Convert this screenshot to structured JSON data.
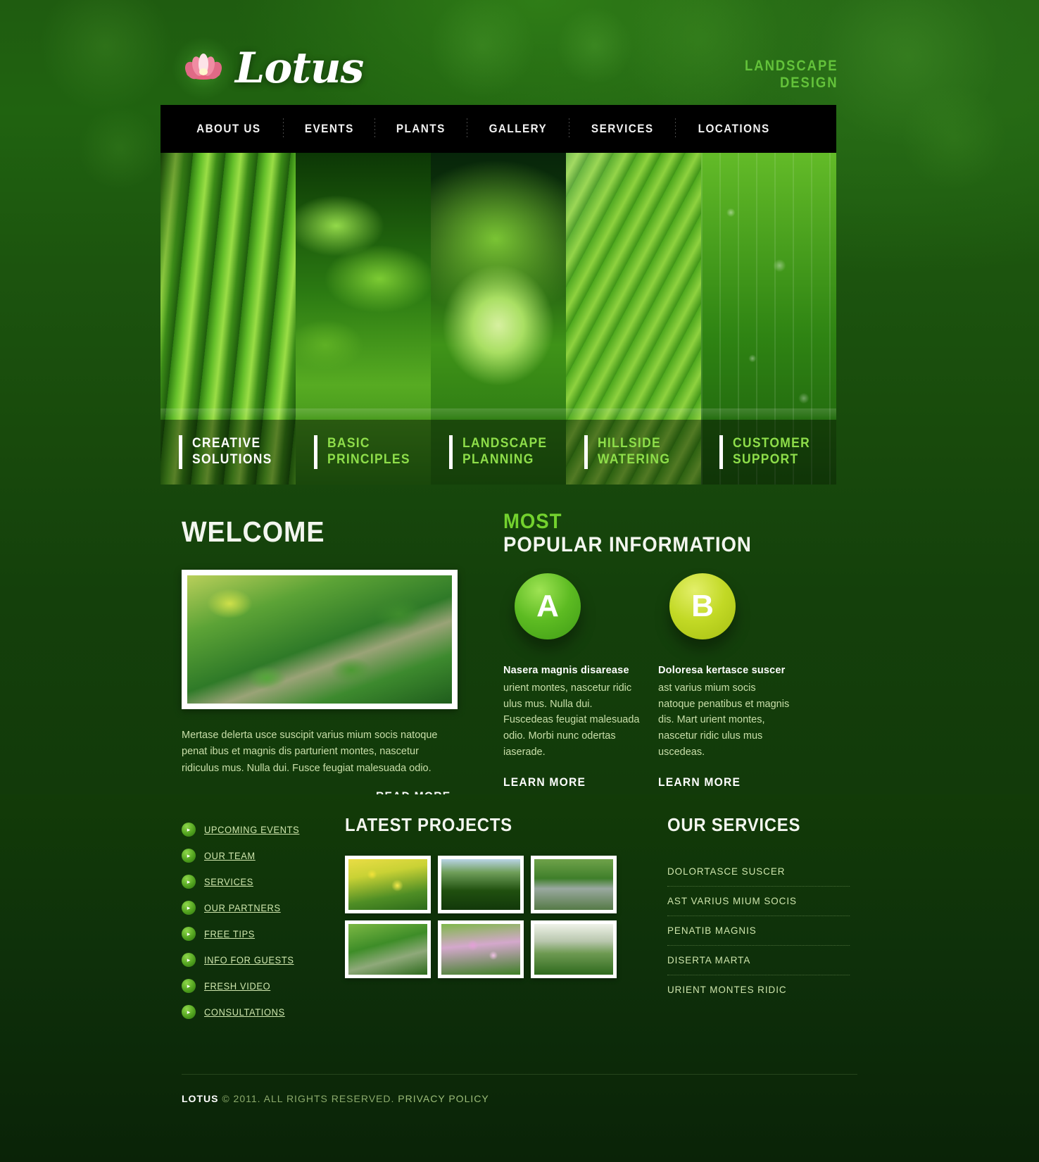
{
  "brand": {
    "name": "Lotus",
    "icon": "lotus-flower-icon",
    "tagline_line1": "LANDSCAPE",
    "tagline_line2": "DESIGN",
    "accent_green": "#73d22e",
    "tagline_color": "#63c23a"
  },
  "nav": {
    "items": [
      {
        "label": "ABOUT US"
      },
      {
        "label": "EVENTS"
      },
      {
        "label": "PLANTS"
      },
      {
        "label": "GALLERY"
      },
      {
        "label": "SERVICES"
      },
      {
        "label": "LOCATIONS"
      }
    ]
  },
  "slider": {
    "slides": [
      {
        "line1": "CREATIVE",
        "line2": "SOLUTIONS",
        "style": "white"
      },
      {
        "line1": "BASIC",
        "line2": "PRINCIPLES",
        "style": "green"
      },
      {
        "line1": "LANDSCAPE",
        "line2": "PLANNING",
        "style": "green"
      },
      {
        "line1": "HILLSIDE",
        "line2": "WATERING",
        "style": "green"
      },
      {
        "line1": "CUSTOMER",
        "line2": "SUPPORT",
        "style": "green"
      }
    ]
  },
  "welcome": {
    "heading": "WELCOME",
    "image_alt": "garden-path-photo",
    "body": "Mertase delerta usce suscipit varius mium socis natoque penat ibus et magnis dis parturient montes, nascetur ridiculus mus. Nulla dui. Fusce feugiat malesuada odio.",
    "read_more": "READ MORE"
  },
  "popular": {
    "heading_top": "MOST",
    "heading_bottom": "POPULAR INFORMATION",
    "columns": [
      {
        "badge": "A",
        "badge_color": "#5dbb22",
        "title": "Nasera magnis disarease",
        "body": "urient montes, nascetur ridic ulus mus. Nulla dui. Fuscedeas feugiat malesuada odio. Morbi nunc odertas iaserade.",
        "link": "LEARN MORE"
      },
      {
        "badge": "B",
        "badge_color": "#c2d925",
        "title": "Doloresa kertasce suscer",
        "body": "ast varius mium socis natoque penatibus et magnis dis. Mart urient montes, nascetur ridic ulus mus uscedeas.",
        "link": "LEARN MORE"
      }
    ]
  },
  "footer": {
    "links": [
      {
        "label": "UPCOMING EVENTS"
      },
      {
        "label": "OUR TEAM"
      },
      {
        "label": "SERVICES"
      },
      {
        "label": "OUR PARTNERS"
      },
      {
        "label": "FREE TIPS"
      },
      {
        "label": "INFO FOR GUESTS"
      },
      {
        "label": "FRESH VIDEO"
      },
      {
        "label": "CONSULTATIONS"
      }
    ],
    "projects": {
      "heading": "LATEST PROJECTS",
      "thumbs": [
        {
          "alt": "yellow-tulips-thumb"
        },
        {
          "alt": "park-landscape-thumb"
        },
        {
          "alt": "stone-bridge-thumb"
        },
        {
          "alt": "pond-garden-thumb"
        },
        {
          "alt": "flower-bed-thumb"
        },
        {
          "alt": "tree-column-thumb"
        }
      ]
    },
    "services": {
      "heading": "OUR SERVICES",
      "items": [
        {
          "label": "DOLORTASCE SUSCER"
        },
        {
          "label": "AST VARIUS MIUM SOCIS"
        },
        {
          "label": "PENATIB MAGNIS"
        },
        {
          "label": "DISERTA MARTA"
        },
        {
          "label": "URIENT MONTES RIDIC"
        }
      ]
    },
    "copyright_brand": "LOTUS",
    "copyright_rest": "© 2011. ALL RIGHTS RESERVED.",
    "privacy_link": "PRIVACY POLICY"
  }
}
